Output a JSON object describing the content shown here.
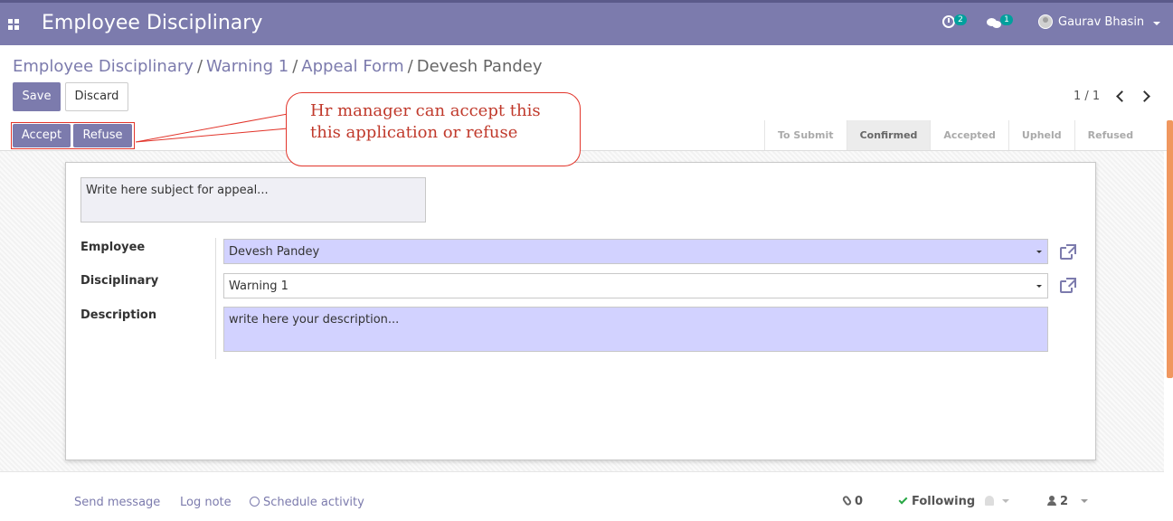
{
  "navbar": {
    "app_title": "Employee Disciplinary",
    "activity_count": "2",
    "message_count": "1",
    "user_name": "Gaurav Bhasin"
  },
  "breadcrumb": {
    "items": [
      "Employee Disciplinary",
      "Warning 1",
      "Appeal Form"
    ],
    "current": "Devesh Pandey",
    "separator": "/"
  },
  "toolbar": {
    "save_label": "Save",
    "discard_label": "Discard"
  },
  "pager": {
    "value": "1 / 1"
  },
  "header_buttons": {
    "accept_label": "Accept",
    "refuse_label": "Refuse"
  },
  "stages": {
    "items": [
      "To Submit",
      "Confirmed",
      "Accepted",
      "Upheld",
      "Refused"
    ],
    "current": "Confirmed"
  },
  "form": {
    "subject_placeholder": "Write here subject for appeal...",
    "employee_label": "Employee",
    "employee_value": "Devesh Pandey",
    "disciplinary_label": "Disciplinary",
    "disciplinary_value": "Warning 1",
    "description_label": "Description",
    "description_placeholder": "write here your description..."
  },
  "annotation": {
    "line1": "Hr manager can accept this",
    "line2": "this application or refuse"
  },
  "chatter": {
    "send_message": "Send message",
    "log_note": "Log note",
    "schedule_activity": "Schedule activity",
    "attachments_count": "0",
    "following_label": "Following",
    "followers_count": "2"
  },
  "colors": {
    "brand": "#7c7bad",
    "required_field": "#d2d2ff",
    "annotation": "#c0392b",
    "following": "#28a745"
  }
}
